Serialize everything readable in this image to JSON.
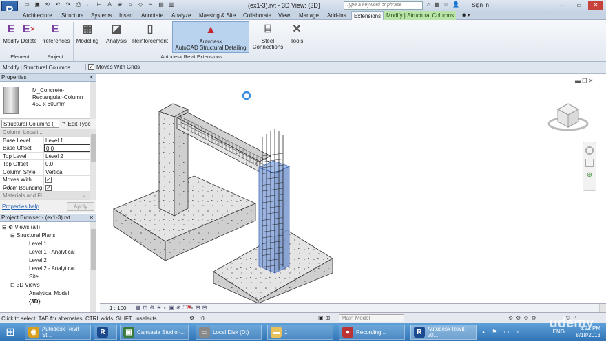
{
  "app": {
    "logo": "R",
    "window_title": "(ex1-3).rvt - 3D View: {3D}",
    "search_placeholder": "Type a keyword or phrase",
    "sign_in": "Sign In"
  },
  "tabs": [
    {
      "label": "Architecture"
    },
    {
      "label": "Structure"
    },
    {
      "label": "Systems"
    },
    {
      "label": "Insert"
    },
    {
      "label": "Annotate"
    },
    {
      "label": "Analyze"
    },
    {
      "label": "Massing & Site"
    },
    {
      "label": "Collaborate"
    },
    {
      "label": "View"
    },
    {
      "label": "Manage"
    },
    {
      "label": "Add-Ins"
    },
    {
      "label": "Extensions"
    },
    {
      "label": "Modify | Structural Columns"
    }
  ],
  "ribbon": {
    "modify": "Modify",
    "delete": "Delete",
    "preferences": "Preferences",
    "modeling": "Modeling",
    "analysis": "Analysis",
    "reinforcement": "Reinforcement",
    "acad_line1": "Autodesk",
    "acad_line2": "AutoCAD Structural Detailing",
    "steel_line1": "Steel",
    "steel_line2": "Connections",
    "tools": "Tools",
    "panel_element": "Element",
    "panel_project": "Project",
    "panel_ext": "Autodesk Revit Extensions"
  },
  "optbar": {
    "context": "Modify | Structural Columns",
    "moves_with_grids": "Moves With Grids"
  },
  "properties": {
    "header": "Properties",
    "type_line1": "M_Concrete-",
    "type_line2": "Rectangular-Column",
    "type_line3": "450 x 600mm",
    "selector": "Structural Columns (",
    "edit_type": "Edit Type",
    "group": "Column Locati...",
    "rows": [
      {
        "k": "Base Level",
        "v": "Level 1"
      },
      {
        "k": "Base Offset",
        "v": "0.0"
      },
      {
        "k": "Top Level",
        "v": "Level 2"
      },
      {
        "k": "Top Offset",
        "v": "0.0"
      },
      {
        "k": "Column Style",
        "v": "Vertical"
      },
      {
        "k": "Moves With Gri...",
        "v": ""
      },
      {
        "k": "Room Bounding",
        "v": ""
      }
    ],
    "materials_group": "Materials and Fi...",
    "help": "Properties help",
    "apply": "Apply"
  },
  "browser": {
    "header": "Project Browser - (ex1-3).rvt",
    "views": "Views (all)",
    "structural_plans": "Structural Plans",
    "plans": [
      "Level 1",
      "Level 1 - Analytical",
      "Level 2",
      "Level 2 - Analytical",
      "Site"
    ],
    "views_3d": "3D Views",
    "views_3d_items": [
      "Analytical Model",
      "{3D}"
    ]
  },
  "viewctl": {
    "scale": "1 : 100"
  },
  "status": {
    "hint": "Click to select, TAB for alternates, CTRL adds, SHIFT unselects.",
    "model": "Main Model",
    "sel_count": ":0",
    "filter_count": ":1"
  },
  "taskbar": {
    "items": [
      {
        "label": "Autodesk Revit St...",
        "icon": "chrome-icon",
        "color": "#d9a020"
      },
      {
        "label": "",
        "icon": "revit-icon",
        "color": "#1d4a8e"
      },
      {
        "label": "Camtasia Studio -...",
        "icon": "camtasia-icon",
        "color": "#3a7a3a"
      },
      {
        "label": "Local Disk (D:)",
        "icon": "disk-icon",
        "color": "#888"
      },
      {
        "label": "1",
        "icon": "folder-icon",
        "color": "#e8c15a"
      },
      {
        "label": "Recording...",
        "icon": "recorder-icon",
        "color": "#b33"
      },
      {
        "label": "Autodesk Revit 20...",
        "icon": "revit-icon",
        "color": "#1d4a8e"
      }
    ],
    "lang": "ENG",
    "time": "8:21 PM",
    "date": "8/18/2013",
    "watermark": "udemy"
  }
}
